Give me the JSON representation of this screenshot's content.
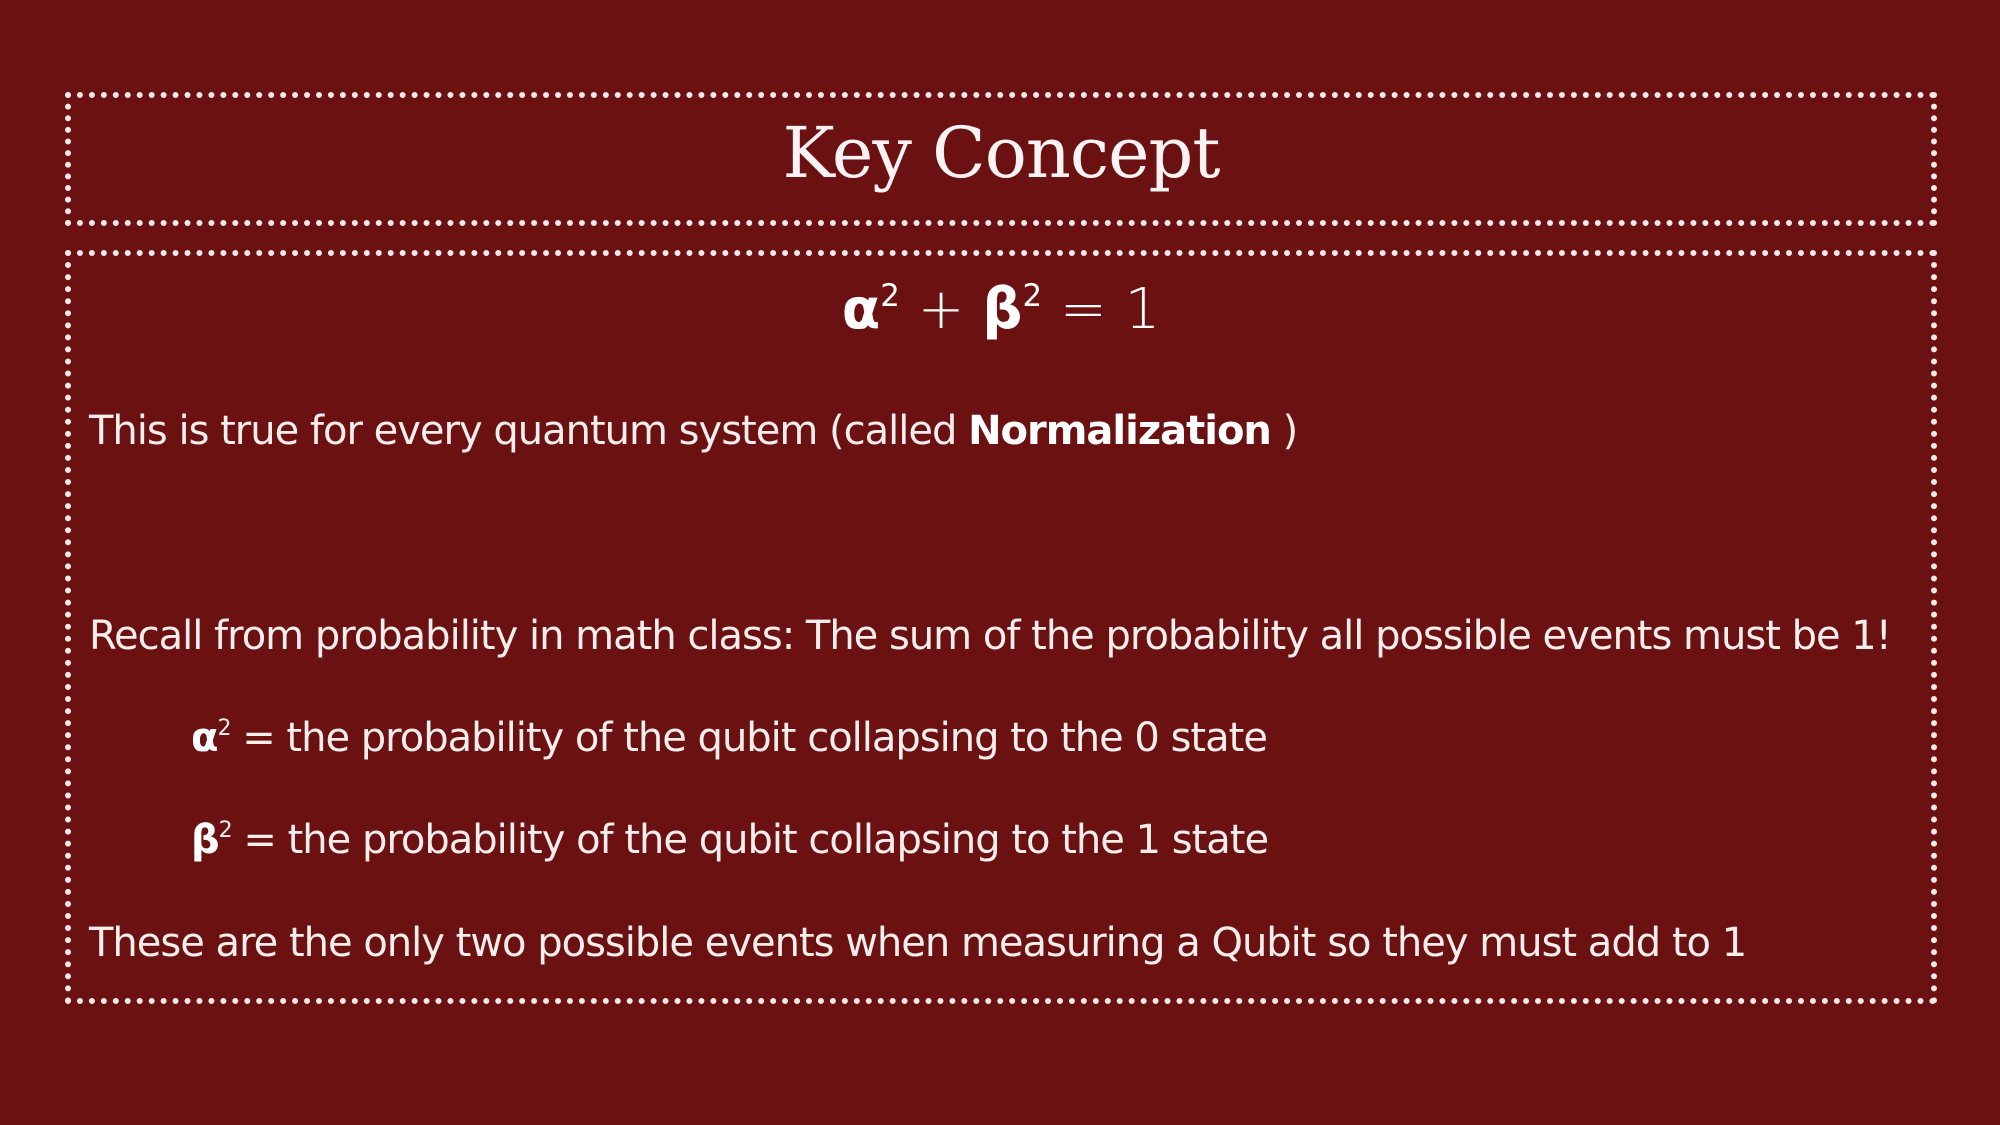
{
  "slide": {
    "title": "Key Concept",
    "equation": {
      "alpha": "α",
      "exp1": "2",
      "plus": " + ",
      "beta": "β",
      "exp2": "2",
      "rhs": " = 1"
    },
    "normalization": {
      "before": "This is true for every quantum system (called ",
      "term": "Normalization",
      "after": "  )"
    },
    "recall": "Recall from probability in math class: The sum of the probability all possible events must be 1!",
    "alpha_def": {
      "symbol": "α",
      "exp": "2",
      "text": " = the probability of the qubit collapsing to the 0 state"
    },
    "beta_def": {
      "symbol": "β",
      "exp": "2",
      "text": " = the probability of the qubit collapsing to the 1 state"
    },
    "conclusion": "These are the only two possible events when measuring a Qubit so they must add to 1"
  },
  "colors": {
    "background": "#6b1112",
    "text": "#ffffff",
    "border": "#f3e9e9"
  }
}
